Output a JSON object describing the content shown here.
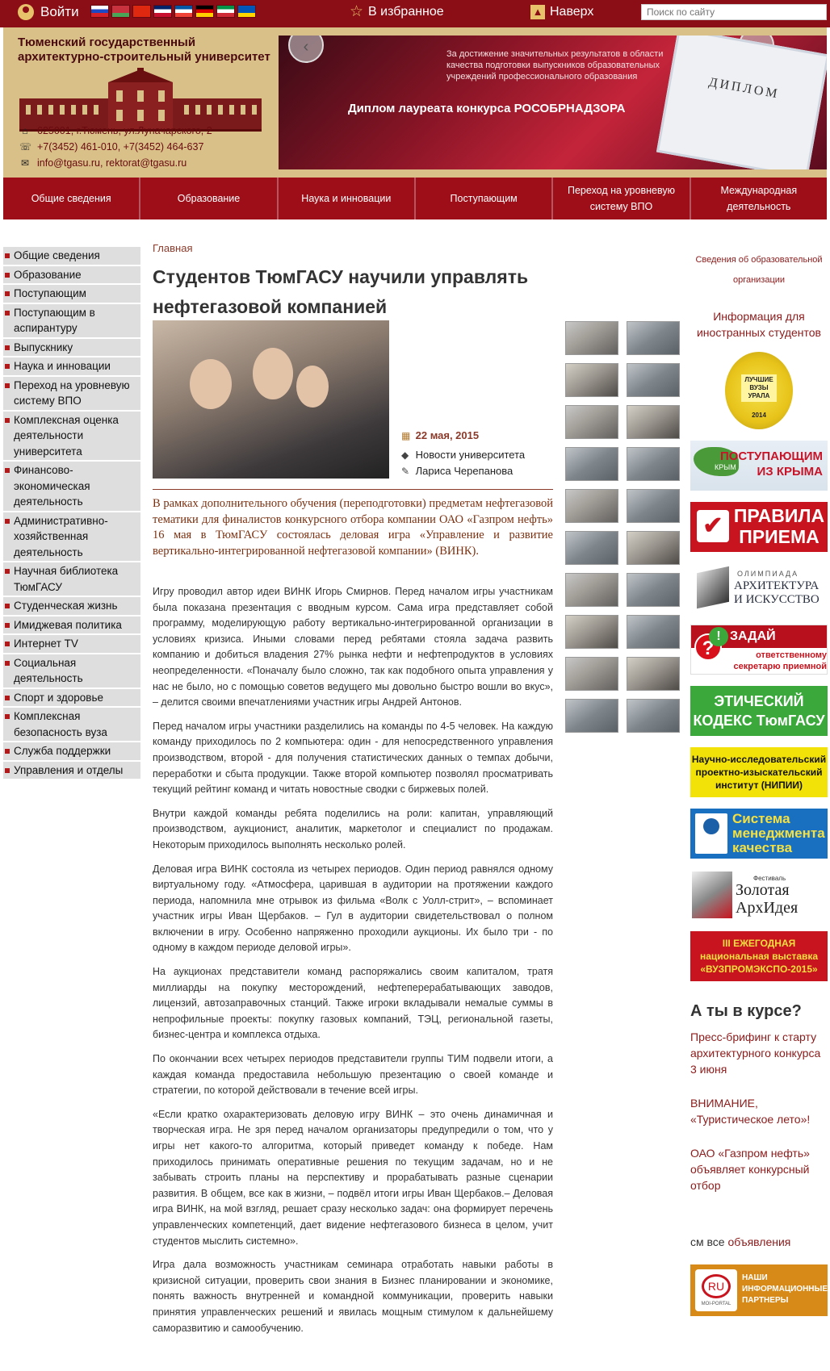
{
  "topbar": {
    "login_label": "Войти",
    "favorites_label": "В избранное",
    "up_label": "Наверх",
    "search_placeholder": "Поиск по сайту",
    "flags": [
      {
        "name": "russia-flag",
        "colors": [
          "#ffffff",
          "#1c49c6",
          "#d6202a"
        ]
      },
      {
        "name": "belarus-flag",
        "colors": [
          "#c8313e",
          "#c8313e",
          "#4aa657"
        ]
      },
      {
        "name": "china-flag",
        "colors": [
          "#de2910",
          "#de2910",
          "#de2910"
        ]
      },
      {
        "name": "uk-flag",
        "colors": [
          "#012169",
          "#ffffff",
          "#c8102e"
        ]
      },
      {
        "name": "france-flag",
        "colors": [
          "#0055a4",
          "#ffffff",
          "#ef4135"
        ]
      },
      {
        "name": "germany-flag",
        "colors": [
          "#000000",
          "#dd0000",
          "#ffce00"
        ]
      },
      {
        "name": "italy-flag",
        "colors": [
          "#009246",
          "#ffffff",
          "#ce2b37"
        ]
      },
      {
        "name": "ukraine-flag",
        "colors": [
          "#0057b7",
          "#0057b7",
          "#ffd700"
        ]
      }
    ]
  },
  "header": {
    "uni_name_line1": "Тюменский государственный",
    "uni_name_line2": "архитектурно-строительный университет",
    "address": "625001, г.Тюмень, ул.Луначарского, 2",
    "phones": "+7(3452) 461-010, +7(3452) 464-637",
    "emails": "info@tgasu.ru, rektorat@tgasu.ru",
    "banner_text": "За достижение значительных результатов в области качества подготовки выпускников образовательных учреждений профессионального образования",
    "banner_title": "Диплом лауреата конкурса РОСОБРНАДЗОРА",
    "diploma_word": "ДИПЛОМ"
  },
  "mainnav": [
    "Общие сведения",
    "Образование",
    "Наука и инновации",
    "Поступающим",
    "Переход на уровневую систему ВПО",
    "Международная деятельность"
  ],
  "leftmenu": [
    "Общие сведения",
    "Образование",
    "Поступающим",
    "Поступающим в аспирантуру",
    "Выпускнику",
    "Наука и инновации",
    "Переход на уровневую систему ВПО",
    "Комплексная оценка деятельности университета",
    "Финансово-экономическая деятельность",
    "Административно-хозяйственная деятельность",
    "Научная библиотека ТюмГАСУ",
    "Студенческая жизнь",
    "Имиджевая политика",
    "Интернет TV",
    "Социальная деятельность",
    "Спорт и здоровье",
    "Комплексная безопасность вуза",
    "Служба поддержки",
    "Управления и отделы"
  ],
  "article": {
    "breadcrumb": "Главная",
    "title": "Студентов ТюмГАСУ научили управлять нефтегазовой компанией",
    "date": "22 мая, 2015",
    "category": "Новости университета",
    "author": "Лариса Черепанова",
    "lead": "В рамках дополнительного обучения (переподготовки) предметам нефтегазовой тематики для финалистов конкурсного отбора компании ОАО «Газпром нефть» 16 мая в ТюмГАСУ состоялась деловая игра «Управление и развитие вертикально-интегрированной нефтегазовой компании» (ВИНК).",
    "paragraphs": [
      "Игру проводил автор идеи ВИНК Игорь Смирнов. Перед началом игры участникам была показана презентация с вводным курсом. Сама игра представляет собой программу, моделирующую работу вертикально-интегрированной организации в условиях кризиса. Иными словами перед ребятами стояла задача развить компанию и добиться владения 27% рынка нефти и нефтепродуктов в условиях неопределенности. «Поначалу было сложно, так как подобного опыта управления у нас не было, но с помощью советов ведущего мы довольно быстро вошли во вкус», – делится своими впечатлениями участник игры Андрей Антонов.",
      "Перед началом игры участники разделились на команды по 4-5 человек. На каждую команду приходилось по 2 компьютера: один - для непосредственного управления производством, второй - для получения статистических данных о темпах добычи, переработки и сбыта продукции. Также второй компьютер позволял просматривать текущий рейтинг команд и читать новостные сводки с биржевых полей.",
      "Внутри каждой команды ребята поделились на роли: капитан, управляющий производством, аукционист, аналитик, маркетолог и специалист по продажам. Некоторым приходилось выполнять несколько ролей.",
      "Деловая игра ВИНК состояла из четырех периодов. Один период равнялся одному виртуальному году. «Атмосфера, царившая в аудитории на протяжении каждого периода, напомнила мне отрывок из фильма «Волк с Уолл-стрит», – вспоминает участник игры Иван Щербаков. – Гул в аудитории свидетельствовал о полном включении в игру. Особенно напряженно проходили аукционы. Их было три - по одному в каждом периоде деловой игры».",
      "На аукционах представители команд распоряжались своим капиталом, тратя миллиарды на покупку месторождений, нефтеперерабатывающих заводов, лицензий, автозаправочных станций. Также игроки вкладывали немалые суммы в непрофильные проекты: покупку газовых компаний, ТЭЦ, региональной газеты, бизнес-центра и комплекса отдыха.",
      "По окончании всех четырех периодов представители группы ТИМ подвели итоги, а каждая команда предоставила небольшую презентацию о своей команде и стратегии, по которой действовали в течение всей игры.",
      "«Если кратко охарактеризовать деловую игру ВИНК – это очень динамичная и творческая игра. Не зря перед началом организаторы предупредили о том, что у игры нет какого-то алгоритма, который приведет команду к победе. Нам приходилось принимать оперативные решения по текущим задачам, но и не забывать строить планы на перспективу и прорабатывать разные сценарии развития. В общем, все как в жизни, – подвёл итоги игры Иван Щербаков.– Деловая игра ВИНК, на мой взгляд, решает сразу несколько задач: она формирует перечень управленческих компетенций, дает видение нефтегазового бизнеса в целом, учит студентов мыслить системно».",
      "Игра дала возможность участникам семинара отработать навыки работы в кризисной ситуации, проверить свои знания в Бизнес планировании и экономике, понять важность внутренней и командной коммуникации, проверить навыки принятия управленческих решений и явилась мощным стимулом к дальнейшему саморазвитию и самообучению."
    ],
    "thumbnail_count": 20
  },
  "right": {
    "svedenia": "Сведения об образовательной организации",
    "foreign_students": "Информация для иностранных студентов",
    "badge_text": "ЛУЧШИЕ ВУЗЫ УРАЛА",
    "badge_year": "2014",
    "crimea_line1": "ПОСТУПАЮЩИМ",
    "crimea_line2": "ИЗ КРЫМА",
    "crimea_map_label": "КРЫМ",
    "rules_line1": "ПРАВИЛА",
    "rules_line2": "ПРИЕМА",
    "olymp_top": "ОЛИМПИАДА",
    "olymp_line1": "АРХИТЕКТУРА",
    "olymp_line2": "И ИСКУССТВО",
    "ask_title": "ЗАДАЙ ВОПРОСЫ",
    "ask_sub": "ответственному секретарю приемной комиссии",
    "ethics": "ЭТИЧЕСКИЙ КОДЕКС ТюмГАСУ",
    "niipi": "Научно-исследовательский проектно-изыскательский институт (НИПИИ)",
    "quality": "Система менеджмента качества",
    "arch_festival": "Фестиваль",
    "arch_line1": "Золотая",
    "arch_line2": "АрхИдея",
    "expo": "III ЕЖЕГОДНАЯ национальная выставка «ВУЗПРОМЭКСПО-2015»",
    "aty_title": "А ты в курсе?",
    "news": [
      "Пресс-брифинг к старту архитектурного конкурса 3 июня",
      "ВНИМАНИЕ, «Туристическое лето»!",
      "ОАО «Газпром нефть» объявляет конкурсный отбор"
    ],
    "see_all_prefix": "см все",
    "see_all_link": "объявления",
    "media_logo": "RU",
    "media_portal": "MOI-PORTAL",
    "media_text": "НАШИ ИНФОРМАЦИОННЫЕ ПАРТНЕРЫ"
  },
  "colors": {
    "brand": "#8b0d15",
    "nav": "#9e0e18",
    "header_bg": "#d8c088",
    "link": "#8b1a1a"
  }
}
